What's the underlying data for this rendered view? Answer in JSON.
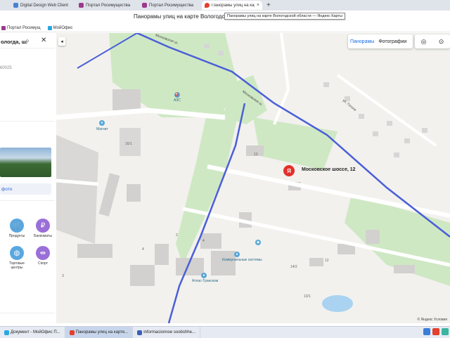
{
  "browser": {
    "tabs": [
      {
        "label": "Digital Design Web Client",
        "color": "#4a7fd6"
      },
      {
        "label": "Портал Росимущества",
        "color": "#9b3a8c"
      },
      {
        "label": "Портал Росимущества",
        "color": "#9b3a8c"
      },
      {
        "label": "Панорамы улиц на карте Вологодской обл",
        "color": "#e3402d",
        "active": true
      }
    ],
    "close_glyph": "×",
    "new_tab_glyph": "+",
    "page_title": "Панорамы улиц на карте Вологодской",
    "tooltip": "Панорамы улиц на карте Вологодской области — Яндекс Карты",
    "bookmarks": [
      {
        "label": "Портал Росимущ",
        "color": "#9b3a8c"
      },
      {
        "label": "МойОфис",
        "color": "#2aa6e0"
      }
    ]
  },
  "panel": {
    "search_text": "ологда, ш.",
    "postcode": "60025",
    "photos_button": "фото",
    "categories": [
      {
        "label": "Продукты",
        "color": "#5aa7e0",
        "icon": "basket-icon"
      },
      {
        "label": "Банкоматы",
        "color": "#9a6fd8",
        "icon": "ruble-icon"
      },
      {
        "label": "Торговые центры",
        "color": "#5aa7e0",
        "icon": "bag-icon"
      },
      {
        "label": "Спорт",
        "color": "#9a6fd8",
        "icon": "dumbbell-icon"
      }
    ]
  },
  "map": {
    "layer_tabs": [
      "Панорамы",
      "Фотографии"
    ],
    "selected_address": "Московское шоссе, 12",
    "marker_glyph": "Я",
    "street_labels": [
      "Московское ш.",
      "Московское ш.",
      "ул. Гоголя"
    ],
    "poi_labels": {
      "azs": "АЗС",
      "magnit": "Магнит",
      "utilities": "Коммунальные системы",
      "atlas": "Атлас-Транском"
    },
    "house_numbers": [
      "13",
      "4",
      "16/1",
      "3",
      "4",
      "14/2",
      "13/1",
      "12",
      "2"
    ],
    "copyright": "© Яндекс  Условия"
  },
  "taskbar": {
    "items": [
      {
        "label": "Документ - МойОфис П...",
        "color": "#2aa6e0"
      },
      {
        "label": "Панорамы улиц на карте...",
        "color": "#e3402d",
        "active": true
      },
      {
        "label": "informacionnoe soobshhe...",
        "color": "#3a5fb5"
      }
    ]
  }
}
